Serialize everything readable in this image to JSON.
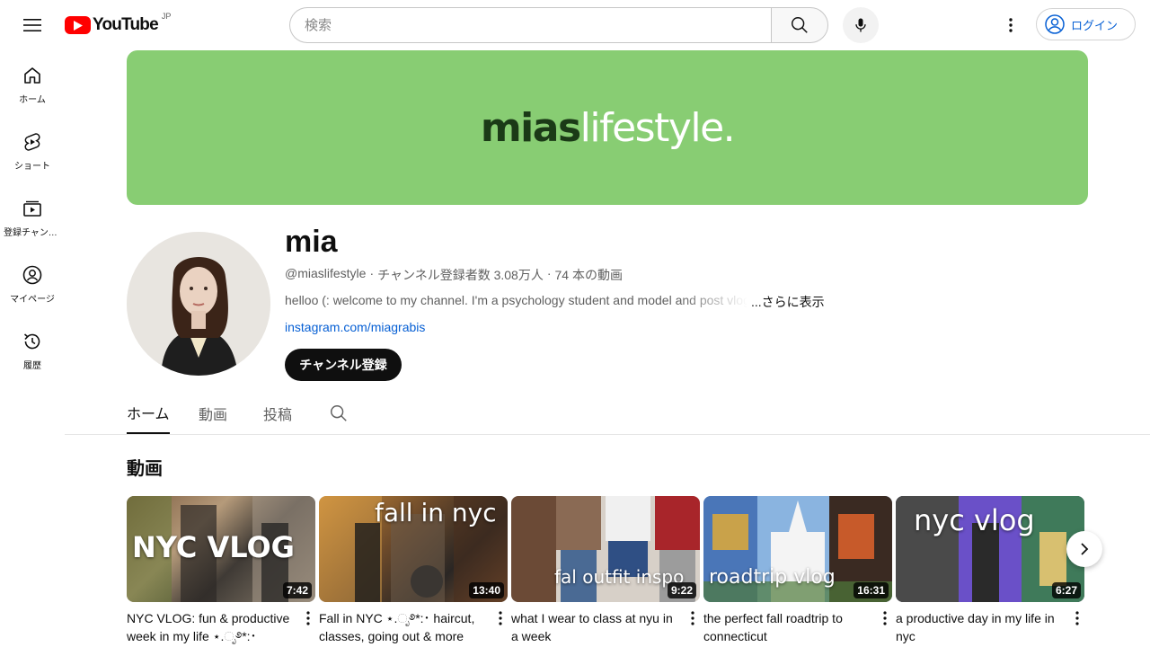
{
  "header": {
    "logo_text": "YouTube",
    "country_code": "JP",
    "search_placeholder": "検索",
    "login_label": "ログイン"
  },
  "sidebar": {
    "items": [
      {
        "label": "ホーム",
        "icon": "home-icon"
      },
      {
        "label": "ショート",
        "icon": "shorts-icon"
      },
      {
        "label": "登録チャンネル",
        "icon": "subscriptions-icon"
      },
      {
        "label": "マイページ",
        "icon": "you-icon"
      },
      {
        "label": "履歴",
        "icon": "history-icon"
      }
    ]
  },
  "banner": {
    "part1": "mias",
    "part2": "lifestyle.",
    "bg_color": "#88cd73"
  },
  "channel": {
    "name": "mia",
    "handle": "@miaslifestyle",
    "subscribers": "チャンネル登録者数 3.08万人",
    "video_count": "74 本の動画",
    "description": "helloo (: welcome to my channel. I'm a psychology student and model and post vlogs",
    "more_label": "...さらに表示",
    "link": "instagram.com/miagrabis",
    "subscribe_label": "チャンネル登録"
  },
  "tabs": [
    {
      "label": "ホーム",
      "active": true
    },
    {
      "label": "動画",
      "active": false
    },
    {
      "label": "投稿",
      "active": false
    }
  ],
  "section": {
    "title": "動画"
  },
  "videos": [
    {
      "title": "NYC VLOG: fun & productive week in my life ⋆.ೃ࿔*:･",
      "duration": "7:42",
      "overlay": "NYC VLOG"
    },
    {
      "title": "Fall in NYC ⋆.ೃ࿔*:･ haircut, classes, going out & more",
      "duration": "13:40",
      "overlay": "fall in nyc"
    },
    {
      "title": "what I wear to class at nyu in a week",
      "duration": "9:22",
      "overlay": "fal outfit inspo"
    },
    {
      "title": "the perfect fall roadtrip to connecticut",
      "duration": "16:31",
      "overlay": "roadtrip vlog"
    },
    {
      "title": "a productive day in my life in nyc",
      "duration": "6:27",
      "overlay": "nyc vlog"
    }
  ]
}
